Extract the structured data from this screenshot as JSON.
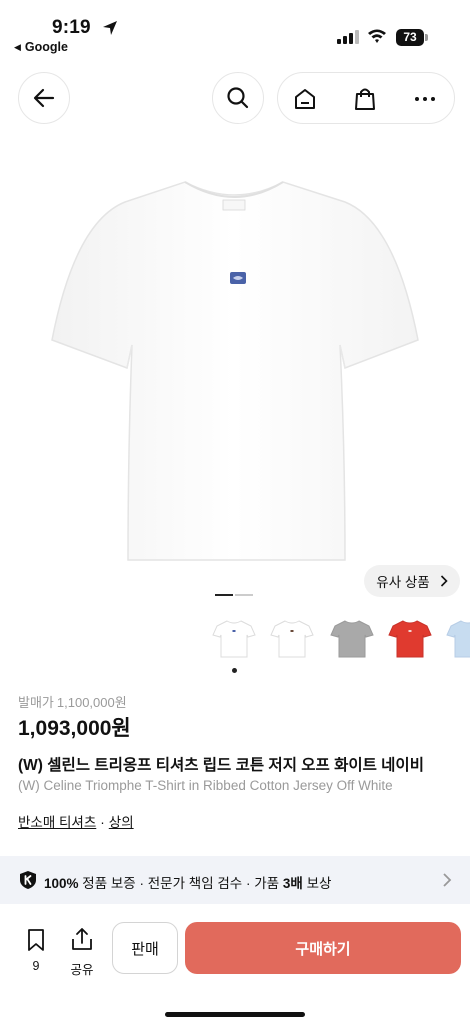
{
  "status_bar": {
    "time": "9:19",
    "back_app": "Google",
    "battery": "73"
  },
  "header": {
    "icons": [
      "back-arrow-icon",
      "search-icon",
      "home-icon",
      "shopping-bag-icon",
      "more-icon"
    ]
  },
  "product": {
    "similar_label": "유사 상품",
    "thumbnail_colors": [
      "#ffffff",
      "#ffffff",
      "#a9a9a9",
      "#e03a2f",
      "#c7dcf0"
    ],
    "original_price_label": "발매가",
    "original_price": "1,100,000원",
    "price": "1,093,000원",
    "name_ko": "(W) 셀린느 트리옹프 티셔츠 립드 코튼 저지 오프 화이트 네이비",
    "name_en": "(W) Celine Triomphe T-Shirt in Ribbed Cotton Jersey Off White",
    "category_1": "반소매 티셔츠",
    "category_sep": "·",
    "category_2": "상의"
  },
  "guarantee": {
    "pct": "100%",
    "part1": "정품 보증",
    "sep": "·",
    "part2": "전문가 책임 검수",
    "part3_a": "가품",
    "part3_b": "3배",
    "part3_c": "보상"
  },
  "bottom_bar": {
    "bookmark_count": "9",
    "share_label": "공유",
    "sell_label": "판매",
    "buy_label": "구매하기"
  },
  "colors": {
    "buy_button": "#e16a5c",
    "guarantee_bg": "#f1f3f8"
  }
}
